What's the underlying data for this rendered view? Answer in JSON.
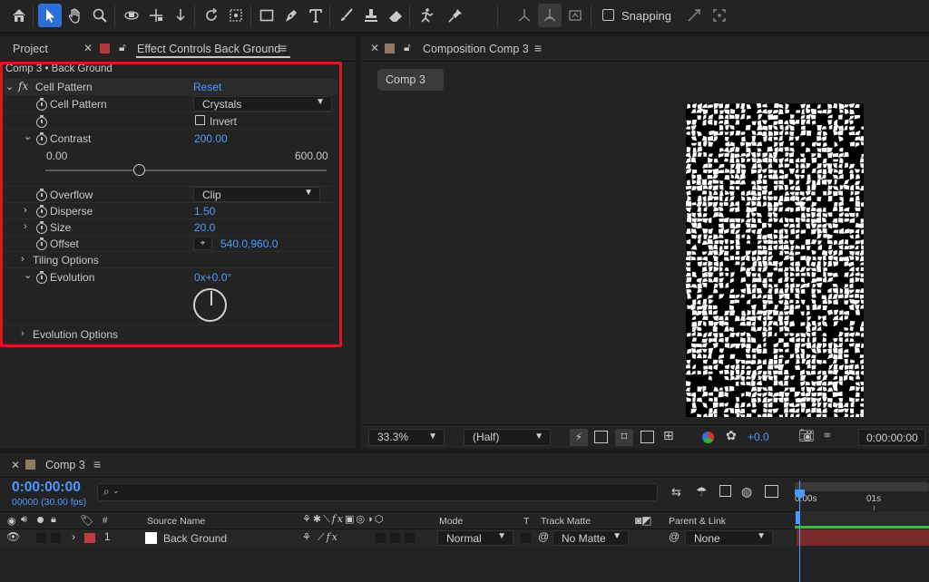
{
  "toolbar": {
    "tools": [
      "home-icon",
      "selection-tool-icon",
      "hand-tool-icon",
      "zoom-tool-icon",
      "orbit-camera-icon",
      "pan-camera-icon",
      "dolly-camera-icon",
      "rotation-tool-icon",
      "pan-behind-icon",
      "rectangle-tool-icon",
      "pen-tool-icon",
      "type-tool-icon",
      "brush-tool-icon",
      "clone-stamp-icon",
      "eraser-tool-icon",
      "roto-brush-icon",
      "puppet-pin-icon"
    ],
    "snapping_label": "Snapping"
  },
  "left_panel": {
    "tab_project": "Project",
    "tab_effect_controls": "Effect Controls Back Ground",
    "breadcrumb": "Comp 3 • Back Ground",
    "effect": {
      "fx_symbol": "fx",
      "name": "Cell Pattern",
      "reset": "Reset",
      "cell_pattern_label": "Cell Pattern",
      "cell_pattern_value": "Crystals",
      "invert_label": "Invert",
      "contrast_label": "Contrast",
      "contrast_value": "200.00",
      "contrast_min": "0.00",
      "contrast_max": "600.00",
      "contrast_fraction": 0.333,
      "overflow_label": "Overflow",
      "overflow_value": "Clip",
      "disperse_label": "Disperse",
      "disperse_value": "1.50",
      "size_label": "Size",
      "size_value": "20.0",
      "offset_label": "Offset",
      "offset_value": "540.0,960.0",
      "tiling_label": "Tiling Options",
      "evolution_label": "Evolution",
      "evolution_value": "0x+0.0°",
      "evolution_options_label": "Evolution Options"
    }
  },
  "composition": {
    "tab_label": "Composition Comp 3",
    "chip_label": "Comp 3",
    "zoom": "33.3%",
    "resolution": "(Half)",
    "exposure": "+0.0",
    "timecode": "0:00:00:00"
  },
  "timeline": {
    "tab_label": "Comp 3",
    "current_time": "0:00:00:00",
    "frame_info": "00000 (30.00 fps)",
    "search_placeholder": "",
    "ruler_labels": [
      "0:00s",
      "01s"
    ],
    "col_hash": "#",
    "col_source_name": "Source Name",
    "col_mode": "Mode",
    "col_t": "T",
    "col_track_matte": "Track Matte",
    "col_parent": "Parent & Link",
    "layer": {
      "number": "1",
      "name": "Back Ground",
      "mode": "Normal",
      "track_matte": "No Matte",
      "parent": "None"
    }
  },
  "colors": {
    "accent_blue": "#2d6fd6",
    "value_blue": "#4a9bff",
    "highlight_red": "#e0151f",
    "layer_label_red": "#c0393b",
    "layer_bar": "#7a2a2a"
  }
}
